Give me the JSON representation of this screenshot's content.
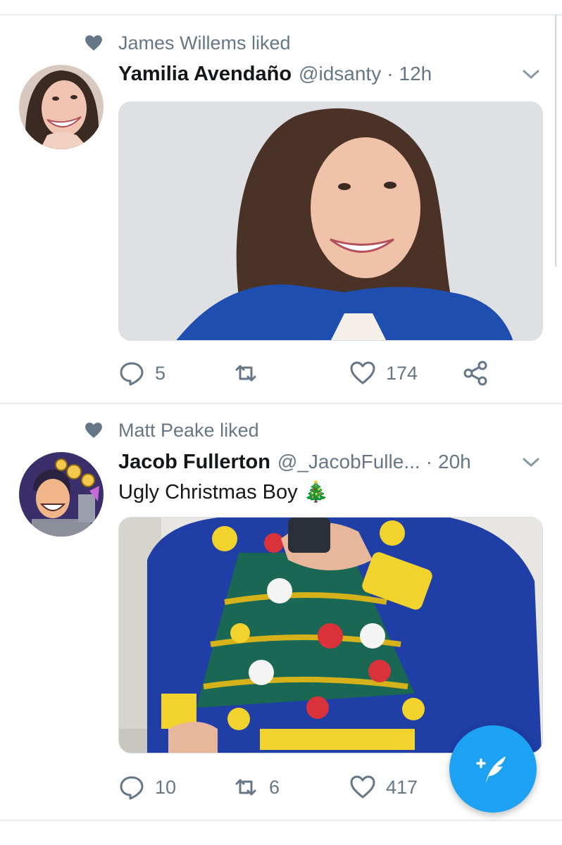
{
  "colors": {
    "accent": "#1da1f2",
    "secondary_text": "#657786",
    "primary_text": "#14171a",
    "divider": "#e6ecf0"
  },
  "tweets": [
    {
      "liked_by": "James Willems liked",
      "name": "Yamilia Avendaño",
      "handle": "@idsanty",
      "separator": "·",
      "time": "12h",
      "text": "",
      "reply_count": "5",
      "retweet_count": "",
      "like_count": "174",
      "icons": [
        "heart-icon",
        "chevron-down-icon",
        "reply-icon",
        "retweet-icon",
        "like-icon",
        "share-icon"
      ]
    },
    {
      "liked_by": "Matt Peake liked",
      "name": "Jacob Fullerton",
      "handle": "@_JacobFulle...",
      "separator": "·",
      "time": "20h",
      "text": "Ugly Christmas Boy 🎄",
      "reply_count": "10",
      "retweet_count": "6",
      "like_count": "417",
      "icons": [
        "heart-icon",
        "chevron-down-icon",
        "reply-icon",
        "retweet-icon",
        "like-icon"
      ]
    }
  ],
  "compose_button": {
    "icon": "compose-feather-icon"
  }
}
